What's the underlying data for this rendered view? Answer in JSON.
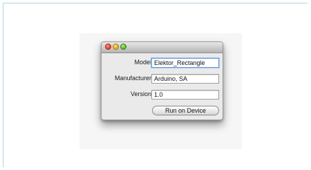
{
  "dialog": {
    "fields": [
      {
        "label": "Model",
        "value": "Elektor_Rectangle"
      },
      {
        "label": "Manufacturer",
        "value": "Arduino, SA"
      },
      {
        "label": "Version",
        "value": "1.0"
      }
    ],
    "action_label": "Run on Device"
  },
  "colors": {
    "close": "#d63a2a",
    "minimize": "#e0a116",
    "zoom": "#4fae2a",
    "frame_border": "#a9d6d9"
  }
}
